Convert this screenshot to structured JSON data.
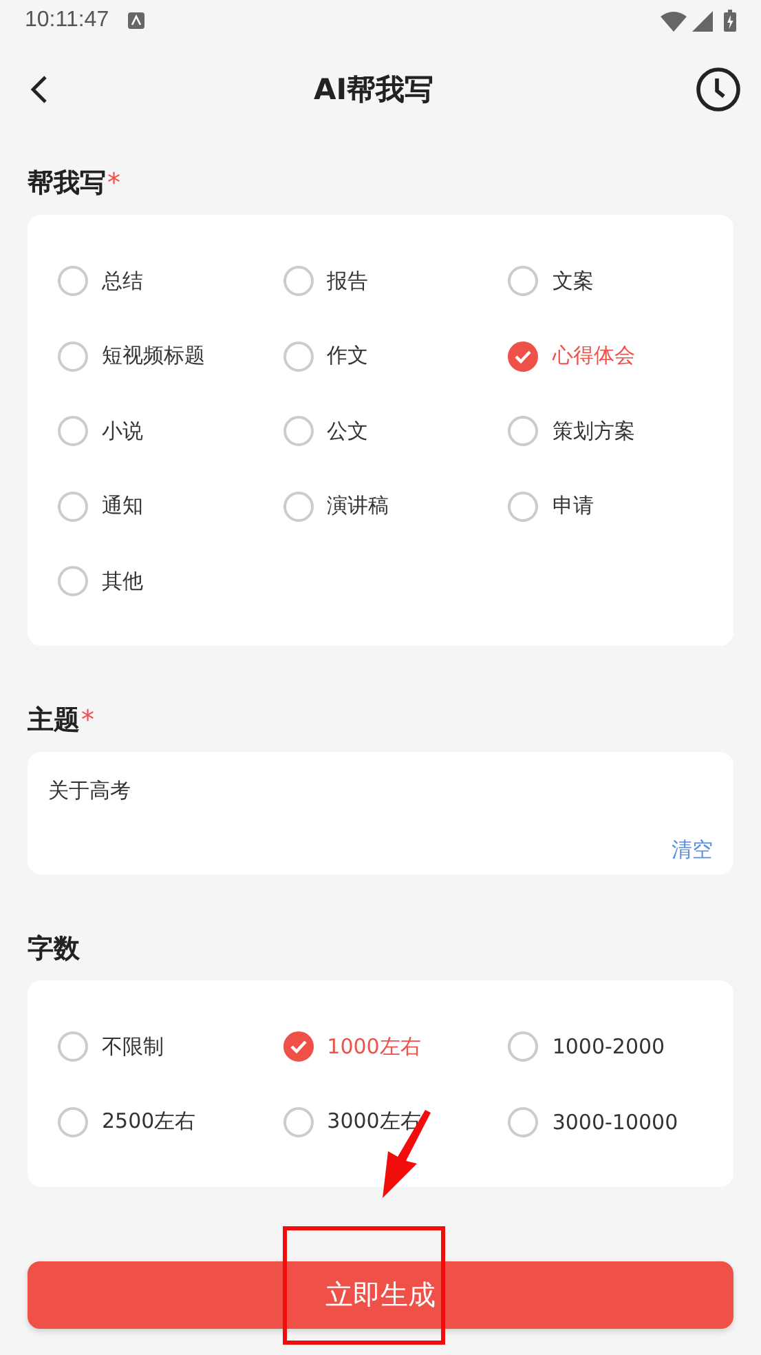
{
  "status_bar": {
    "time": "10:11:47"
  },
  "header": {
    "title": "AI帮我写"
  },
  "sections": [
    {
      "kind": "options",
      "title": "帮我写",
      "required_mark": "*",
      "options": [
        {
          "label": "总结",
          "selected": false
        },
        {
          "label": "报告",
          "selected": false
        },
        {
          "label": "文案",
          "selected": false
        },
        {
          "label": "短视频标题",
          "selected": false
        },
        {
          "label": "作文",
          "selected": false
        },
        {
          "label": "心得体会",
          "selected": true
        },
        {
          "label": "小说",
          "selected": false
        },
        {
          "label": "公文",
          "selected": false
        },
        {
          "label": "策划方案",
          "selected": false
        },
        {
          "label": "通知",
          "selected": false
        },
        {
          "label": "演讲稿",
          "selected": false
        },
        {
          "label": "申请",
          "selected": false
        },
        {
          "label": "其他",
          "selected": false
        }
      ]
    },
    {
      "kind": "text",
      "title": "主题",
      "required_mark": "*",
      "value": "关于高考",
      "clear_label": "清空"
    },
    {
      "kind": "options",
      "title": "字数",
      "options": [
        {
          "label": "不限制",
          "selected": false
        },
        {
          "label": "1000左右",
          "selected": true
        },
        {
          "label": "1000-2000",
          "selected": false
        },
        {
          "label": "2500左右",
          "selected": false
        },
        {
          "label": "3000左右",
          "selected": false
        },
        {
          "label": "3000-10000",
          "selected": false
        }
      ]
    }
  ],
  "submit": {
    "label": "立即生成"
  }
}
